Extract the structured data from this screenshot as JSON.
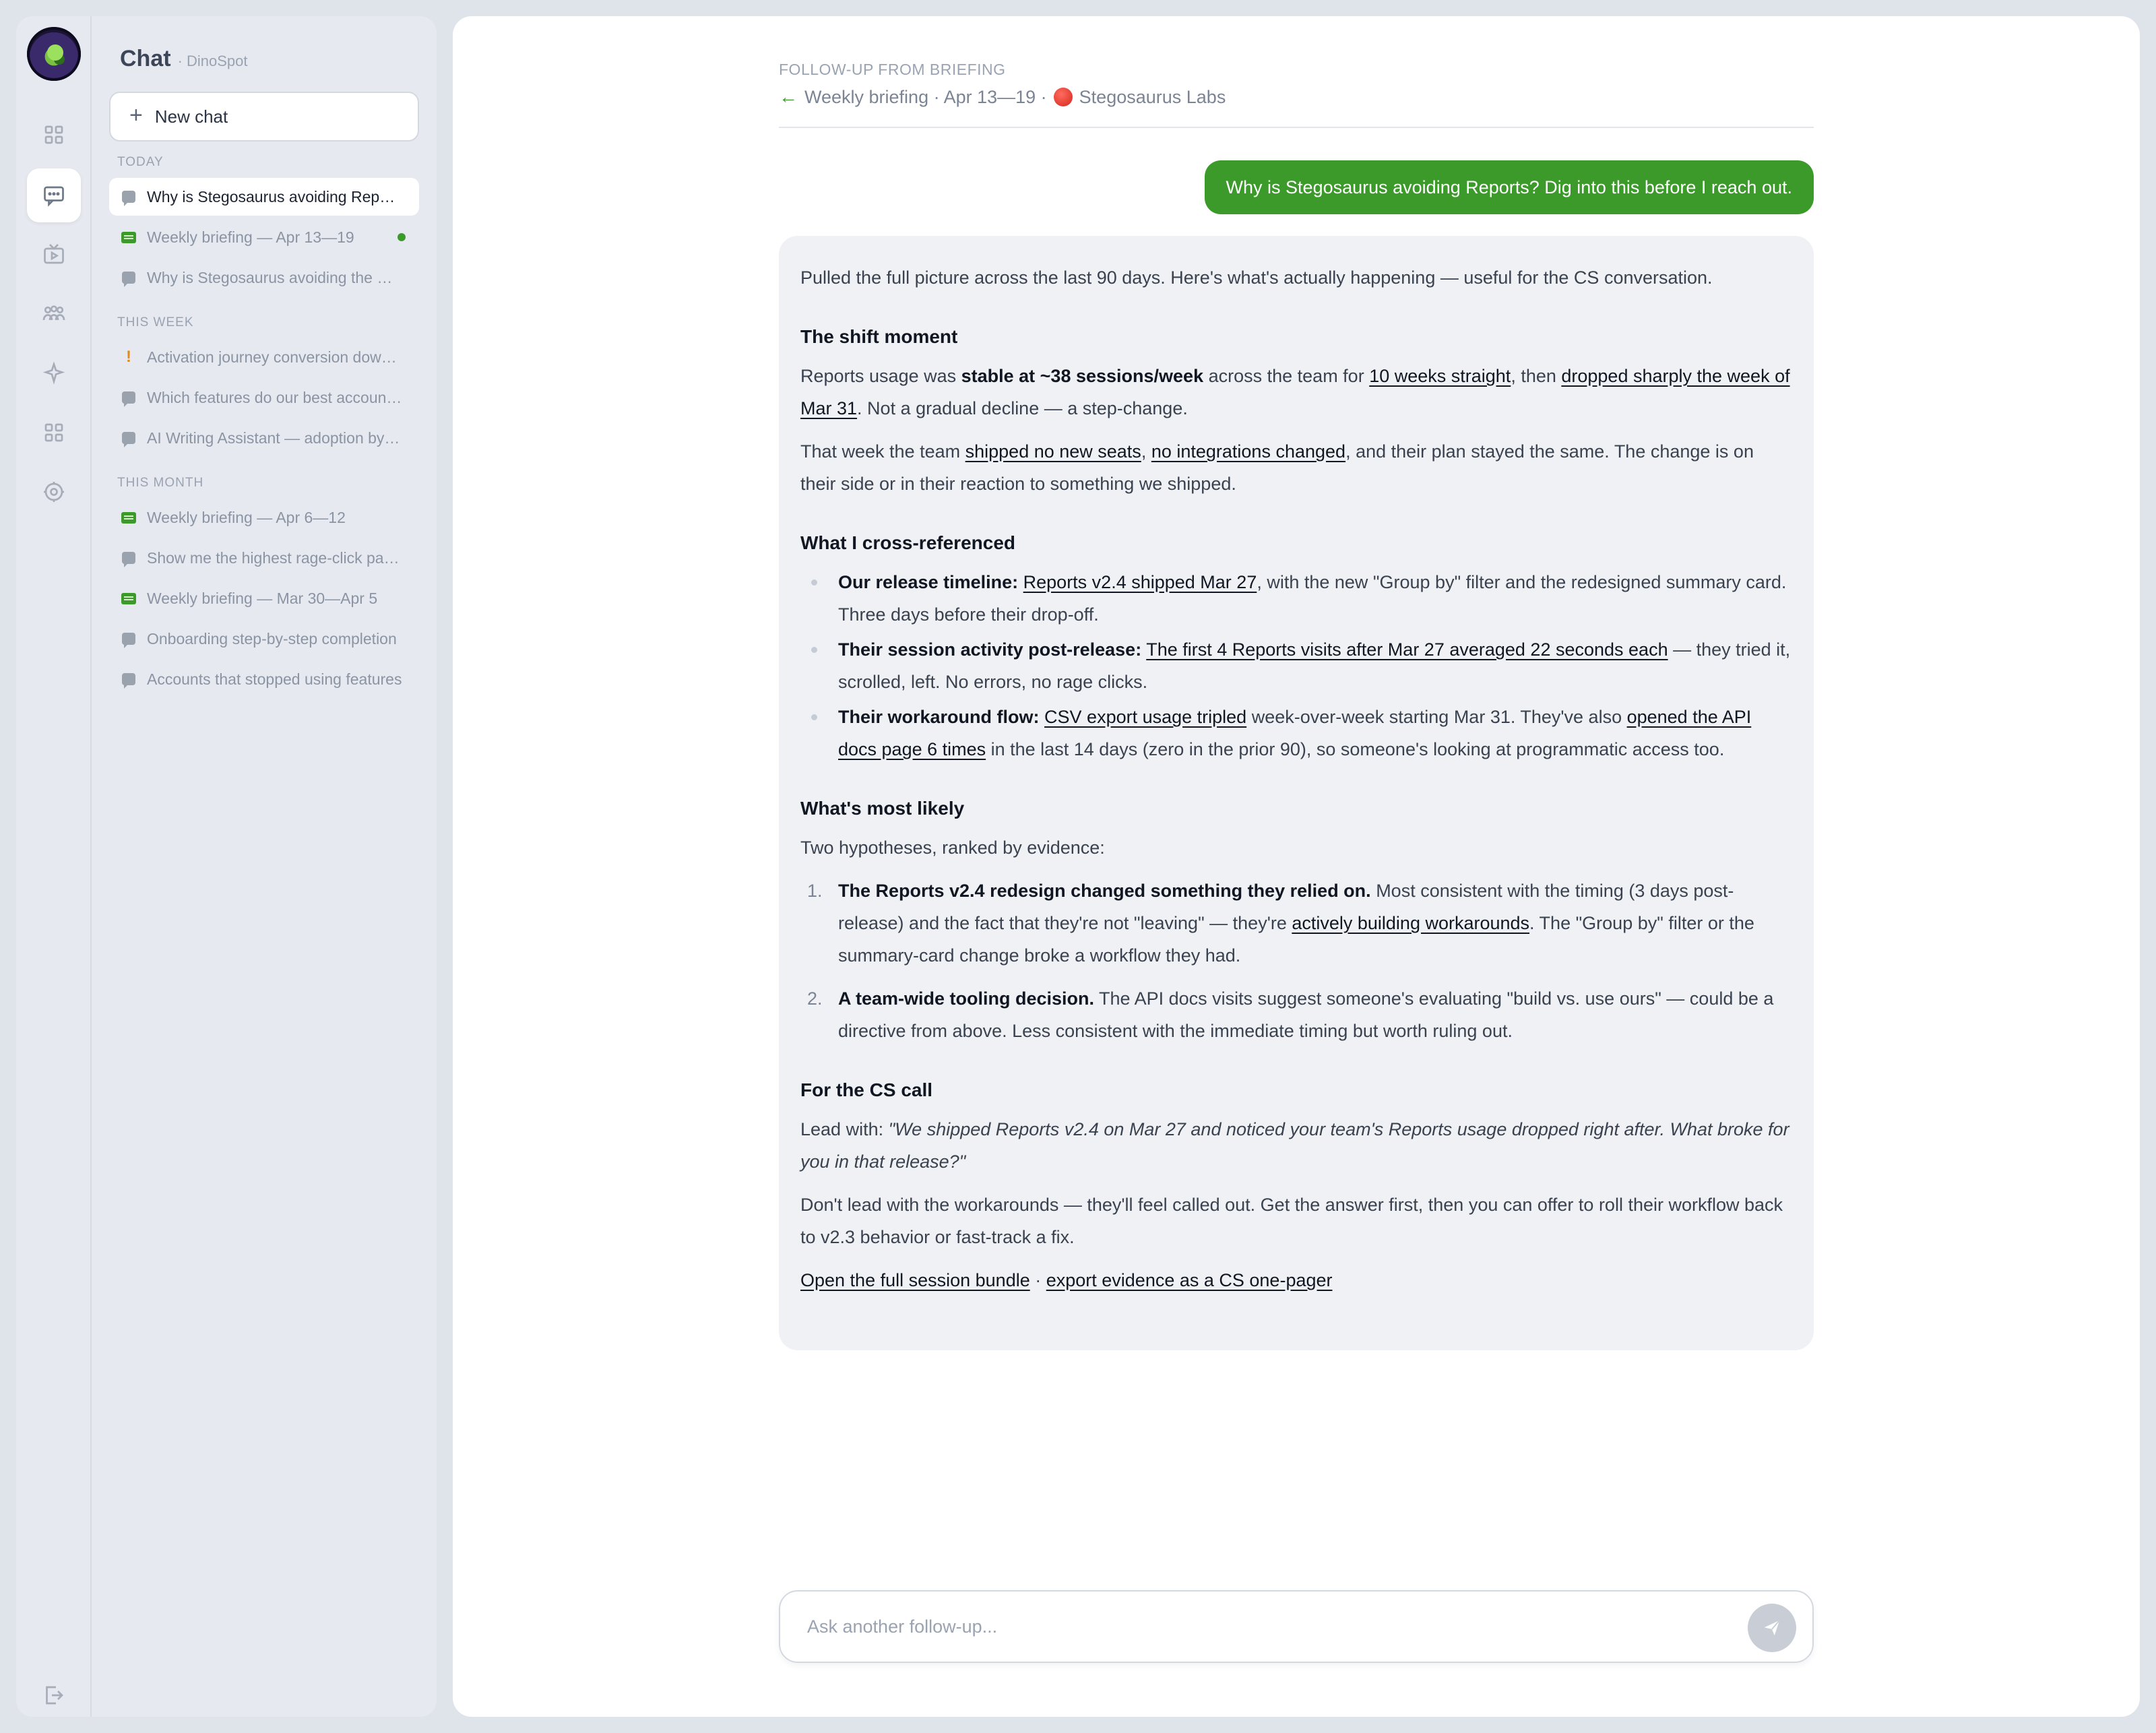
{
  "sidebar": {
    "title": "Chat",
    "subtitle": "· DinoSpot",
    "new_chat_label": "New chat",
    "sections": [
      {
        "label": "TODAY"
      },
      {
        "label": "THIS WEEK"
      },
      {
        "label": "THIS MONTH"
      }
    ],
    "items": [
      {
        "label": "Why is Stegosaurus avoiding Reports? Dig into this before I reach out.",
        "icon": "chat-bubble-icon",
        "active": true
      },
      {
        "label": "Weekly briefing — Apr 13—19",
        "icon": "briefing-icon",
        "unread": true
      },
      {
        "label": "Why is Stegosaurus avoiding the Reports page?",
        "icon": "chat-bubble-icon"
      },
      {
        "label": "Activation journey conversion dowdown",
        "icon": "alert-icon"
      },
      {
        "label": "Which features do our best accounts use?",
        "icon": "chat-bubble-icon"
      },
      {
        "label": "AI Writing Assistant — adoption by plan",
        "icon": "chat-bubble-icon"
      },
      {
        "label": "Weekly briefing — Apr 6—12",
        "icon": "briefing-icon"
      },
      {
        "label": "Show me the highest rage-click pages",
        "icon": "chat-bubble-icon"
      },
      {
        "label": "Weekly briefing — Mar 30—Apr 5",
        "icon": "briefing-icon"
      },
      {
        "label": "Onboarding step-by-step completion",
        "icon": "chat-bubble-icon"
      },
      {
        "label": "Accounts that stopped using features",
        "icon": "chat-bubble-icon"
      }
    ]
  },
  "header": {
    "context_label": "FOLLOW-UP FROM BRIEFING",
    "briefing": "Weekly briefing · Apr 13—19 ·",
    "account": "Stegosaurus Labs"
  },
  "conversation": {
    "user_message": "Why is Stegosaurus avoiding Reports? Dig into this before I reach out.",
    "answer": {
      "intro": "Pulled the full picture across the last 90 days. Here's what's actually happening — useful for the CS conversation.",
      "shift": {
        "heading": "The shift moment",
        "p1_a": "Reports usage was ",
        "p1_b": "stable at ~38 sessions/week",
        "p1_c": " across the team for ",
        "p1_link1": "10 weeks straight",
        "p1_d": ", then ",
        "p1_link2": "dropped sharply the week of Mar 31",
        "p1_e": ". Not a gradual decline — a step-change.",
        "p2_a": "That week the team ",
        "p2_link1": "shipped no new seats",
        "p2_b": ", ",
        "p2_link2": "no integrations changed",
        "p2_c": ", and their plan stayed the same. The change is on their side or in their reaction to something we shipped."
      },
      "cross": {
        "heading": "What I cross-referenced",
        "b1_label": "Our release timeline:",
        "b1_link": "Reports v2.4 shipped Mar 27",
        "b1_rest": ", with the new \"Group by\" filter and the redesigned summary card. Three days before their drop-off.",
        "b2_label": "Their session activity post-release:",
        "b2_link": "The first 4 Reports visits after Mar 27 averaged 22 seconds each",
        "b2_rest": " — they tried it, scrolled, left. No errors, no rage clicks.",
        "b3_label": "Their workaround flow:",
        "b3_link1": "CSV export usage tripled",
        "b3_mid": " week-over-week starting Mar 31. They've also ",
        "b3_link2": "opened the API docs page 6 times",
        "b3_rest": " in the last 14 days (zero in the prior 90), so someone's looking at programmatic access too."
      },
      "likely": {
        "heading": "What's most likely",
        "intro": "Two hypotheses, ranked by evidence:",
        "h1_num": "1.",
        "h1_bold": "The Reports v2.4 redesign changed something they relied on.",
        "h1_a": " Most consistent with the timing (3 days post-release) and the fact that they're not \"leaving\" — they're ",
        "h1_link": "actively building workarounds",
        "h1_b": ". The \"Group by\" filter or the summary-card change broke a workflow they had.",
        "h2_num": "2.",
        "h2_bold": "A team-wide tooling decision.",
        "h2_rest": " The API docs visits suggest someone's evaluating \"build vs. use ours\" — could be a directive from above. Less consistent with the immediate timing but worth ruling out."
      },
      "cs": {
        "heading": "For the CS call",
        "lead_label": "Lead with: ",
        "lead_quote": "\"We shipped Reports v2.4 on Mar 27 and noticed your team's Reports usage dropped right after. What broke for you in that release?\"",
        "advice": "Don't lead with the workarounds — they'll feel called out. Get the answer first, then you can offer to roll their workflow back to v2.3 behavior or fast-track a fix.",
        "link1": "Open the full session bundle",
        "sep": " · ",
        "link2": "export evidence as a CS one-pager"
      }
    }
  },
  "composer": {
    "placeholder": "Ask another follow-up...",
    "value": ""
  },
  "colors": {
    "accent": "#3c9a2a",
    "background": "#dfe3ea",
    "panel": "#e6e9ef",
    "answer_bg": "#eff1f4"
  }
}
